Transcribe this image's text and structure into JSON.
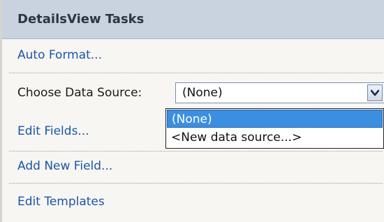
{
  "header": {
    "title": "DetailsView Tasks"
  },
  "tasks": {
    "auto_format": "Auto Format...",
    "choose_data_source_label": "Choose Data Source:",
    "edit_fields": "Edit Fields...",
    "add_new_field": "Add New Field...",
    "edit_templates": "Edit Templates"
  },
  "data_source_select": {
    "selected_value": "(None)",
    "options": [
      "(None)",
      "<New data source...>"
    ],
    "highlighted_index": 0
  },
  "icons": {
    "dropdown_arrow": "chevron-down-icon"
  },
  "colors": {
    "header_bg": "#c9d3df",
    "link": "#1b55a8",
    "highlight": "#3b8fe0"
  }
}
